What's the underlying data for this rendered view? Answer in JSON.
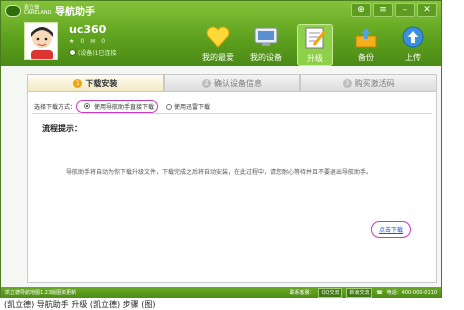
{
  "brand": {
    "logo_text": "嘉立博 CARELAND",
    "app_title": "导航助手"
  },
  "window_controls": [
    "⊕",
    "≡",
    "–",
    "✕"
  ],
  "user": {
    "name": "uc360",
    "msg_count": "0",
    "mail_count": "0",
    "device_status": "(设备)1已连接"
  },
  "nav": [
    {
      "label": "我的最爱",
      "icon": "heart-icon"
    },
    {
      "label": "我的设备",
      "icon": "device-icon"
    },
    {
      "label": "升级",
      "icon": "upgrade-icon"
    },
    {
      "label": "备份",
      "icon": "backup-icon"
    },
    {
      "label": "上传",
      "icon": "upload-icon"
    }
  ],
  "colors": {
    "header": "#5fa21f",
    "accent": "#f2a20c",
    "highlight": "#c53dbd",
    "link": "#1a56c7"
  },
  "steps": [
    {
      "num": "1",
      "label": "下载安装"
    },
    {
      "num": "2",
      "label": "确认设备信息"
    },
    {
      "num": "3",
      "label": "购买激活码"
    }
  ],
  "method": {
    "label": "选择下载方式：",
    "option1": "使用导航助手直接下载",
    "option2": "使用迅雷下载"
  },
  "tips": {
    "title": "流程提示：",
    "text": "导航助手将自动为你下载升级文件，下载完成之后将自动安装，在此过程中，请您耐心等待并且不要退出导航助手。"
  },
  "download_link": "点击下载",
  "footer": {
    "left": "凯立德导航地图1.23版图资更新",
    "service": "联系客服：",
    "btn1": "QQ交流",
    "btn2": "新浪交流",
    "phone": "电话：400-000-0110"
  },
  "caption": "(凯立德) 导航助手 升级 (凯立德) 步骤 (图)"
}
